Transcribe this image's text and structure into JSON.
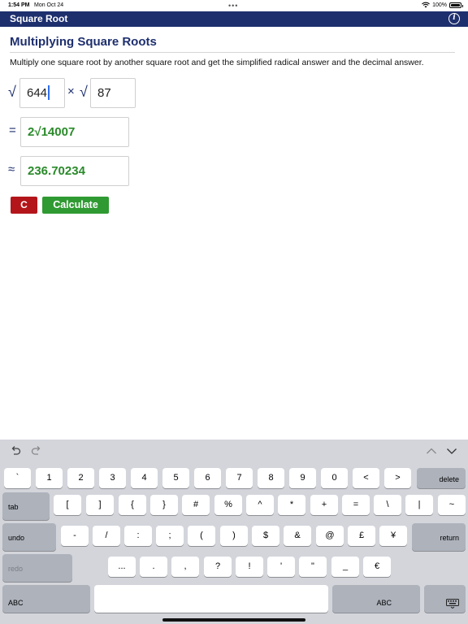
{
  "status": {
    "time": "1:54 PM",
    "date": "Mon Oct 24",
    "dots": "•••",
    "battery": "100%"
  },
  "header": {
    "title": "Square Root",
    "info_icon_label": "i"
  },
  "main": {
    "title": "Multiplying Square Roots",
    "description": "Multiply one square root by another square root and get the simplified radical answer and the decimal answer.",
    "symbols": {
      "sqrt": "√",
      "times": "×",
      "equals": "=",
      "approx": "≈"
    },
    "input_a": "644",
    "input_b": "87",
    "simplified_result": "2√14007",
    "decimal_result": "236.70234",
    "clear_label": "C",
    "calculate_label": "Calculate"
  },
  "keyboard": {
    "toolbar_icons": [
      "undo-arrow-icon",
      "redo-arrow-icon",
      "chevron-up-icon",
      "chevron-down-icon"
    ],
    "row1": [
      "`",
      "1",
      "2",
      "3",
      "4",
      "5",
      "6",
      "7",
      "8",
      "9",
      "0",
      "<",
      ">"
    ],
    "delete_label": "delete",
    "tab_label": "tab",
    "row2": [
      "[",
      "]",
      "{",
      "}",
      "#",
      "%",
      "^",
      "*",
      "+",
      "=",
      "\\",
      "|",
      "~"
    ],
    "undo_label": "undo",
    "row3": [
      "-",
      "/",
      ":",
      ";",
      "(",
      ")",
      "$",
      "&",
      "@",
      "£",
      "¥"
    ],
    "return_label": "return",
    "redo_label": "redo",
    "row4": [
      "...",
      ".",
      ",",
      "?",
      "!",
      "'",
      "\"",
      "_",
      "€"
    ],
    "abc_left": "ABC",
    "abc_right": "ABC",
    "keyboard_icon": "keyboard-hide-icon"
  }
}
